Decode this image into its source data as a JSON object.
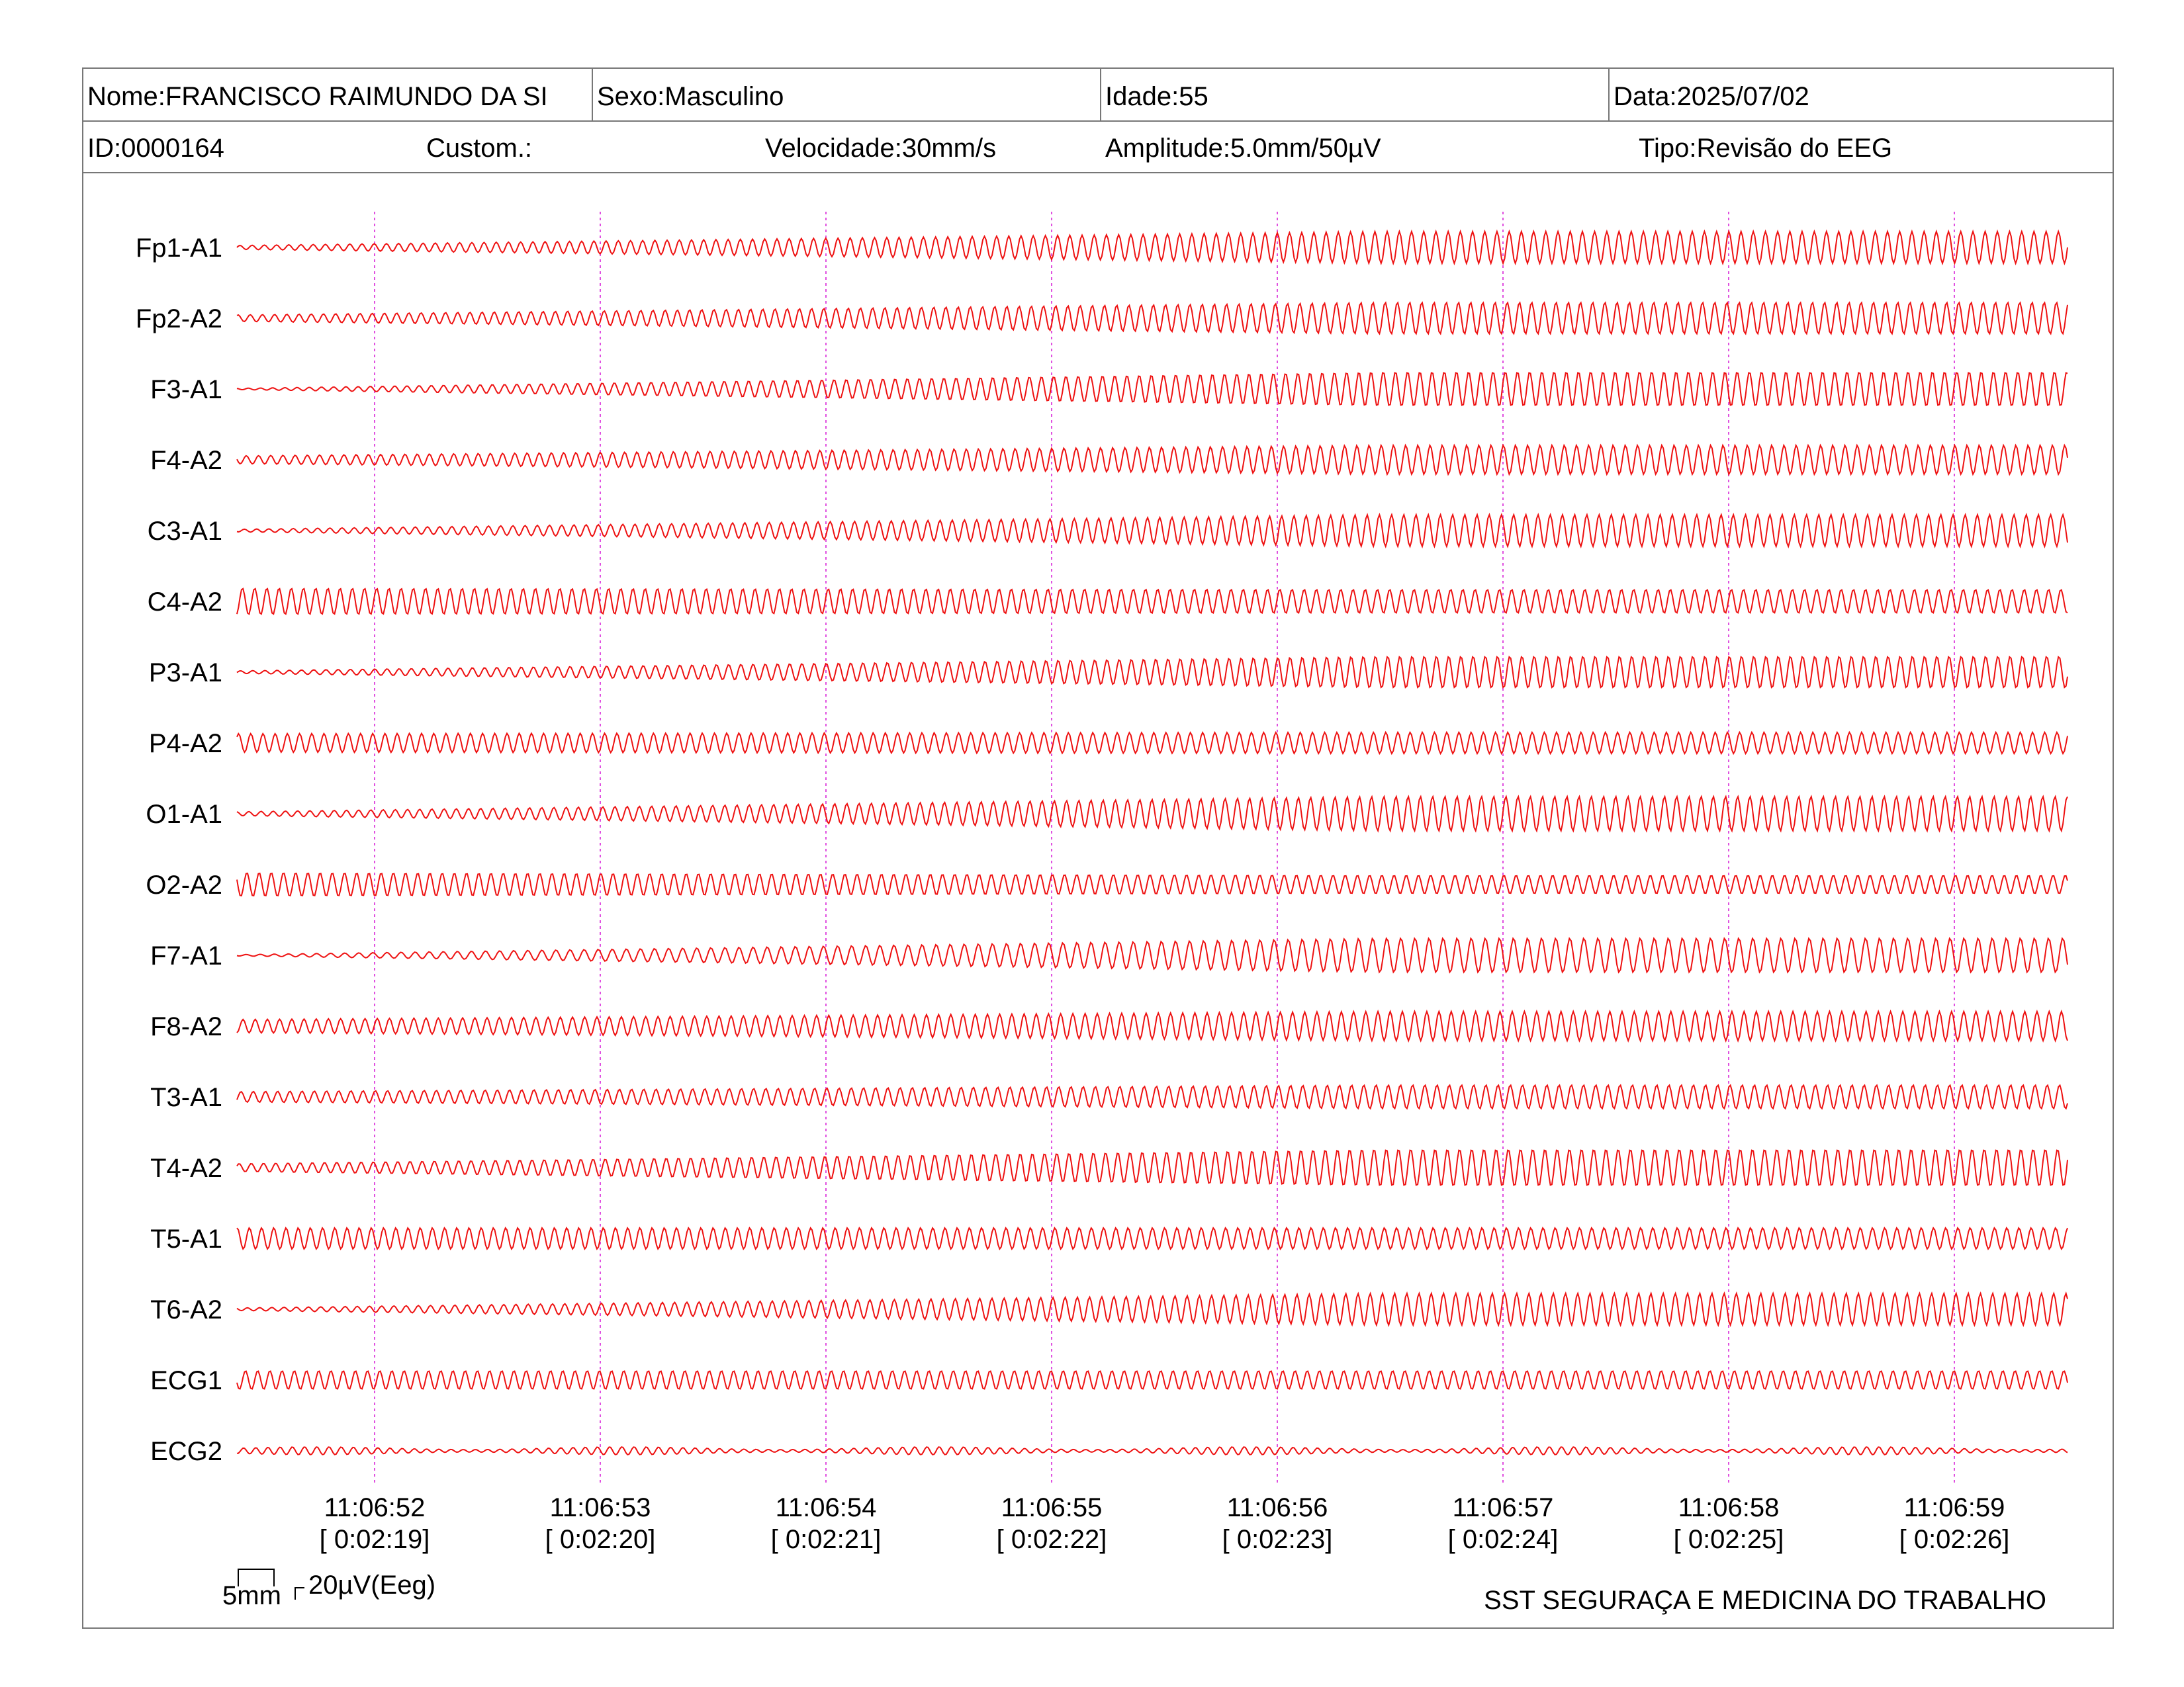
{
  "header": {
    "nome": "Nome:FRANCISCO RAIMUNDO DA SI",
    "sexo": "Sexo:Masculino",
    "idade": "Idade:55",
    "data": "Data:2025/07/02",
    "id": "ID:0000164",
    "custom": "Custom.:",
    "velocidade": "Velocidade:30mm/s",
    "amplitude": "Amplitude:5.0mm/50µV",
    "tipo": "Tipo:Revisão do EEG"
  },
  "channels": [
    "Fp1-A1",
    "Fp2-A2",
    "F3-A1",
    "F4-A2",
    "C3-A1",
    "C4-A2",
    "P3-A1",
    "P4-A2",
    "O1-A1",
    "O2-A2",
    "F7-A1",
    "F8-A2",
    "T3-A1",
    "T4-A2",
    "T5-A1",
    "T6-A2",
    "ECG1",
    "ECG2"
  ],
  "time_markers": [
    {
      "clock": "11:06:52",
      "elapsed": "[ 0:02:19]"
    },
    {
      "clock": "11:06:53",
      "elapsed": "[ 0:02:20]"
    },
    {
      "clock": "11:06:54",
      "elapsed": "[ 0:02:21]"
    },
    {
      "clock": "11:06:55",
      "elapsed": "[ 0:02:22]"
    },
    {
      "clock": "11:06:56",
      "elapsed": "[ 0:02:23]"
    },
    {
      "clock": "11:06:57",
      "elapsed": "[ 0:02:24]"
    },
    {
      "clock": "11:06:58",
      "elapsed": "[ 0:02:25]"
    },
    {
      "clock": "11:06:59",
      "elapsed": "[ 0:02:26]"
    }
  ],
  "scale": {
    "time": "5mm",
    "amplitude": "20µV(Eeg)"
  },
  "footer": "SST SEGURAÇA E MEDICINA DO TRABALHO",
  "colors": {
    "trace": "#ee1111",
    "marker": "#e050e0",
    "border": "#777777"
  }
}
